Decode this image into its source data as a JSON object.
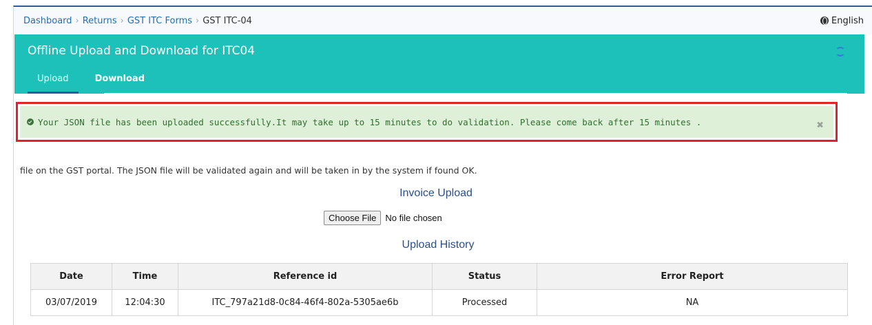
{
  "breadcrumb": {
    "items": [
      "Dashboard",
      "Returns",
      "GST ITC Forms"
    ],
    "current": "GST ITC-04"
  },
  "language": {
    "label": "English",
    "icon": "globe-icon"
  },
  "panel": {
    "title": "Offline Upload and Download for ITC04",
    "tabs": [
      {
        "label": "Upload",
        "active": true
      },
      {
        "label": "Download",
        "active": false
      }
    ],
    "color": "#1ec1ba"
  },
  "alert": {
    "message": "Your JSON file has been uploaded successfully.It may take up to 15 minutes to do validation. Please come back after 15 minutes .",
    "border_color": "#e0222a",
    "bg_color": "#dff0d8"
  },
  "info_text": "file on the GST portal. The JSON file will be validated again and will be taken in by the system if found OK.",
  "invoice_upload": {
    "title": "Invoice Upload",
    "button_label": "Choose File",
    "file_status": "No file chosen"
  },
  "upload_history": {
    "title": "Upload History",
    "columns": [
      "Date",
      "Time",
      "Reference id",
      "Status",
      "Error Report"
    ],
    "rows": [
      [
        "03/07/2019",
        "12:04:30",
        "ITC_797a21d8-0c84-46f4-802a-5305ae6b",
        "Processed",
        "NA"
      ]
    ]
  }
}
